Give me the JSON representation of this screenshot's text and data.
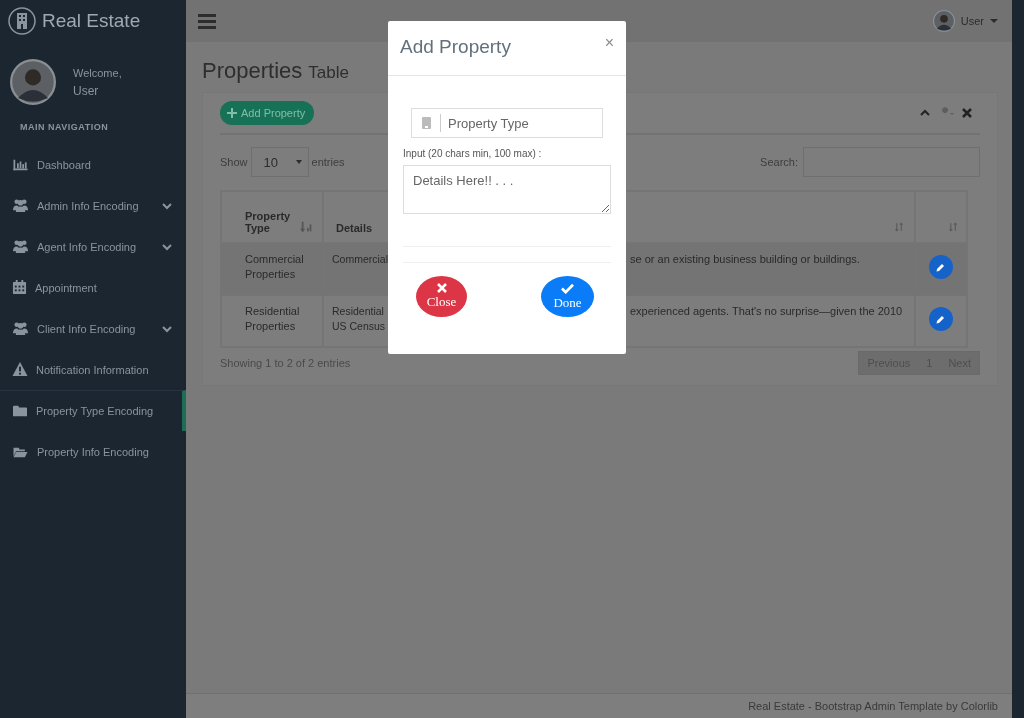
{
  "sidebar": {
    "brand": "Real Estate",
    "welcome": "Welcome,",
    "user": "User",
    "section": "MAIN NAVIGATION",
    "items": [
      {
        "label": "Dashboard",
        "kind": "chart",
        "expandable": false,
        "selected": false
      },
      {
        "label": "Admin Info Encoding",
        "kind": "users",
        "expandable": true,
        "selected": false
      },
      {
        "label": "Agent Info Encoding",
        "kind": "users",
        "expandable": true,
        "selected": false
      },
      {
        "label": "Appointment",
        "kind": "calendar",
        "expandable": false,
        "selected": false
      },
      {
        "label": "Client Info Encoding",
        "kind": "users",
        "expandable": true,
        "selected": false
      },
      {
        "label": "Notification Information",
        "kind": "warning",
        "expandable": false,
        "selected": false
      },
      {
        "label": "Property Type Encoding",
        "kind": "folder",
        "expandable": false,
        "selected": true
      },
      {
        "label": "Property Info Encoding",
        "kind": "folder-open",
        "expandable": false,
        "selected": false
      }
    ]
  },
  "topbar": {
    "user": "User"
  },
  "page": {
    "title": "Properties",
    "subtitle": "Table"
  },
  "panel": {
    "add_button": "Add Property",
    "length": {
      "prefix": "Show",
      "value": "10",
      "suffix": "entries"
    },
    "search": {
      "label": "Search:"
    },
    "table": {
      "columns": [
        {
          "label": "Property Type"
        },
        {
          "label": "Details"
        }
      ],
      "rows": [
        {
          "property_type": "Commercial Properties",
          "details_left": [
            "Commercial"
          ],
          "details_right": [
            "se or an existing business building or buildings."
          ]
        },
        {
          "property_type": "Residential Properties",
          "details_left": [
            "Residential",
            "US Census"
          ],
          "details_right": [
            "experienced agents. That's no surprise—given the 2010"
          ]
        }
      ]
    },
    "info": "Showing 1 to 2 of 2 entries",
    "pagination": [
      "Previous",
      "1",
      "Next"
    ]
  },
  "footer": "Real Estate - Bootstrap Admin Template by Colorlib",
  "modal": {
    "title": "Add Property",
    "close": "×",
    "field": {
      "placeholder": "Property Type"
    },
    "hint": "Input (20 chars min, 100 max) :",
    "details": {
      "placeholder": "Details Here!! . . ."
    },
    "buttons": [
      {
        "label": "Close",
        "kind": "danger"
      },
      {
        "label": "Done",
        "kind": "primary"
      }
    ]
  }
}
